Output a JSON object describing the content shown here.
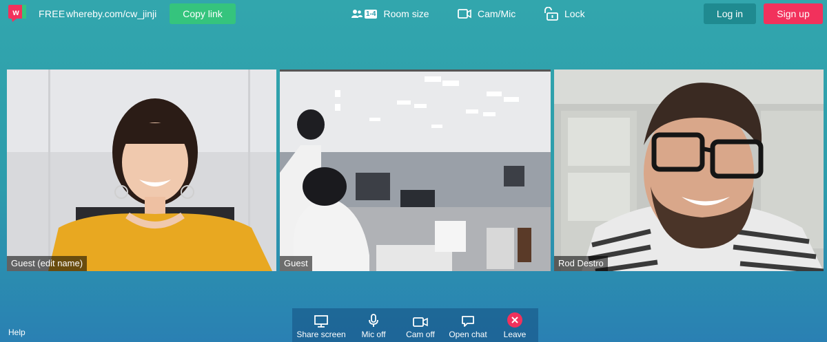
{
  "header": {
    "plan": "FREE",
    "room_url": "whereby.com/cw_jinji",
    "copy_link_label": "Copy link",
    "room_size_badge": "1-4",
    "room_size_label": "Room size",
    "cam_mic_label": "Cam/Mic",
    "lock_label": "Lock",
    "login_label": "Log in",
    "signup_label": "Sign up"
  },
  "participants": [
    {
      "name": "Guest (edit name)"
    },
    {
      "name": "Guest"
    },
    {
      "name": "Rod Destro"
    }
  ],
  "controls": {
    "share_screen": "Share screen",
    "mic_off": "Mic off",
    "cam_off": "Cam off",
    "open_chat": "Open chat",
    "leave": "Leave"
  },
  "footer": {
    "help": "Help"
  },
  "colors": {
    "brand": "#f2315c",
    "copy_button": "#35c47d",
    "login_button": "#1f8a90"
  }
}
